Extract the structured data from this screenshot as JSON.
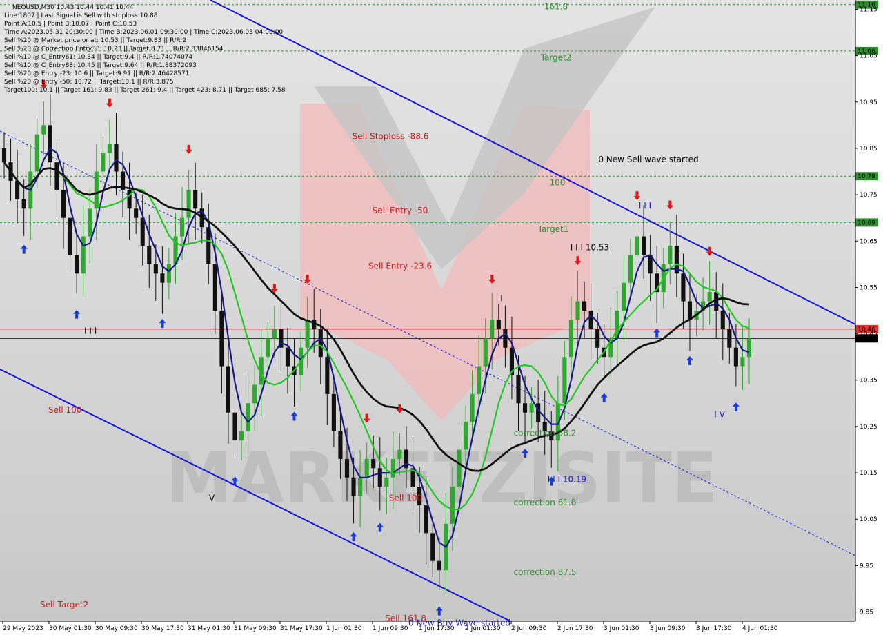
{
  "header": {
    "symbol_line": "NEOUSD,M30  10.43 10.44 10.41 10.44",
    "info_lines": [
      "Line:1807 | Last Signal is:Sell with stoploss:10.88",
      "Point A:10.5 | Point B:10.07 | Point C:10.53",
      "Time A:2023.05.31 20:30:00 | Time B:2023.06.01 09:30:00 | Time C:2023.06.03 04:00:00",
      "Sell %20 @ Market price or at: 10.53 || Target:9.83 || R/R:2",
      "Sell %20 @ Correction Entry38: 10.23 || Target:8.71 || R/R:2.33846154",
      "Sell %10 @ C_Entry61: 10.34 || Target:9.4 || R/R:1.74074074",
      "Sell %10 @ C_Entry88: 10.45 || Target:9.64 || R/R:1.88372093",
      "Sell %20 @ Entry -23: 10.6 || Target:9.91 || R/R:2.46428571",
      "Sell %20 @ Entry -50: 10.72 || Target:10.1 || R/R:3.875",
      "Target100: 10.1 || Target 161: 9.83 || Target 261: 9.4 || Target 423: 8.71 || Target 685: 7.58"
    ]
  },
  "chart_data": {
    "type": "candlestick",
    "symbol": "NEOUSD",
    "timeframe": "M30",
    "ylim": [
      9.83,
      11.17
    ],
    "y_ticks": [
      11.15,
      11.05,
      10.95,
      10.85,
      10.75,
      10.65,
      10.55,
      10.45,
      10.35,
      10.25,
      10.15,
      10.05,
      9.95,
      9.85
    ],
    "x_ticks": [
      "29 May 2023",
      "30 May 01:30",
      "30 May 09:30",
      "30 May 17:30",
      "31 May 01:30",
      "31 May 09:30",
      "31 May 17:30",
      "1 Jun 01:30",
      "1 Jun 09:30",
      "1 Jun 17:30",
      "2 Jun 01:30",
      "2 Jun 09:30",
      "2 Jun 17:30",
      "3 Jun 01:30",
      "3 Jun 09:30",
      "3 Jun 17:30",
      "4 Jun 01:30"
    ],
    "price_levels": [
      {
        "label": "11.16",
        "value": 11.16,
        "kind": "target",
        "color": "#2e8b2e"
      },
      {
        "label": "11.06",
        "value": 11.06,
        "kind": "target",
        "color": "#2e8b2e"
      },
      {
        "label": "10.79",
        "value": 10.79,
        "kind": "target",
        "color": "#2e8b2e"
      },
      {
        "label": "10.69",
        "value": 10.69,
        "kind": "target",
        "color": "#2e8b2e"
      },
      {
        "label": "10.46",
        "value": 10.46,
        "kind": "stop",
        "color": "#e03030"
      },
      {
        "label": "10.44",
        "value": 10.44,
        "kind": "current",
        "color": "#000000"
      }
    ],
    "annotations": [
      {
        "text": "161.8",
        "price": 11.15,
        "color": "#2e8b2e",
        "at": "upper-mid"
      },
      {
        "text": "Target2",
        "price": 11.04,
        "color": "#2e8b2e",
        "at": "upper-mid"
      },
      {
        "text": "Sell Stoploss -88.6",
        "price": 10.87,
        "color": "#c02020",
        "at": "upper-left-mid"
      },
      {
        "text": "0 New Sell wave started",
        "price": 10.82,
        "color": "#000000",
        "at": "upper-right"
      },
      {
        "text": "100",
        "price": 10.77,
        "color": "#2e8b2e",
        "at": "mid"
      },
      {
        "text": "Sell Entry -50",
        "price": 10.71,
        "color": "#c02020",
        "at": "left-mid"
      },
      {
        "text": "Target1",
        "price": 10.67,
        "color": "#2e8b2e",
        "at": "mid"
      },
      {
        "text": "I I I 10.53",
        "price": 10.63,
        "color": "#000000",
        "at": "mid-right"
      },
      {
        "text": "Sell Entry -23.6",
        "price": 10.59,
        "color": "#c02020",
        "at": "left-mid"
      },
      {
        "text": "I I I",
        "price": 10.72,
        "color": "#1a1ad0",
        "at": "right"
      },
      {
        "text": "I",
        "price": 10.52,
        "color": "#000000",
        "at": "mid"
      },
      {
        "text": "I I I",
        "price": 10.45,
        "color": "#000000",
        "at": "far-left"
      },
      {
        "text": "Sell 100",
        "price": 10.28,
        "color": "#c02020",
        "at": "far-left"
      },
      {
        "text": "I V",
        "price": 10.27,
        "color": "#1a1ad0",
        "at": "right"
      },
      {
        "text": "correction 38.2",
        "price": 10.23,
        "color": "#2e8b2e",
        "at": "mid"
      },
      {
        "text": "I I I 10.19",
        "price": 10.13,
        "color": "#1a1ad0",
        "at": "mid"
      },
      {
        "text": "V",
        "price": 10.09,
        "color": "#000000",
        "at": "left"
      },
      {
        "text": "Sell 100",
        "price": 10.09,
        "color": "#c02020",
        "at": "left-mid"
      },
      {
        "text": "correction 61.8",
        "price": 10.08,
        "color": "#2e8b2e",
        "at": "mid"
      },
      {
        "text": "correction 87.5",
        "price": 9.93,
        "color": "#2e8b2e",
        "at": "mid"
      },
      {
        "text": "Sell Target2",
        "price": 9.86,
        "color": "#c02020",
        "at": "far-left"
      },
      {
        "text": "Sell 161.8",
        "price": 9.83,
        "color": "#c02020",
        "at": "left-mid"
      },
      {
        "text": "0 New Buy Wave started",
        "price": 9.82,
        "color": "#1a1ad0",
        "at": "left-mid"
      }
    ],
    "close_series_approx": [
      10.82,
      10.78,
      10.74,
      10.72,
      10.8,
      10.88,
      10.9,
      10.82,
      10.76,
      10.7,
      10.62,
      10.58,
      10.66,
      10.72,
      10.8,
      10.84,
      10.86,
      10.8,
      10.76,
      10.72,
      10.7,
      10.64,
      10.6,
      10.58,
      10.56,
      10.6,
      10.66,
      10.7,
      10.76,
      10.72,
      10.68,
      10.6,
      10.5,
      10.38,
      10.28,
      10.22,
      10.24,
      10.3,
      10.34,
      10.4,
      10.44,
      10.46,
      10.42,
      10.38,
      10.36,
      10.42,
      10.48,
      10.46,
      10.4,
      10.32,
      10.24,
      10.18,
      10.14,
      10.1,
      10.14,
      10.18,
      10.16,
      10.12,
      10.14,
      10.18,
      10.2,
      10.16,
      10.12,
      10.08,
      10.02,
      9.96,
      9.94,
      10.04,
      10.12,
      10.2,
      10.26,
      10.32,
      10.38,
      10.44,
      10.48,
      10.46,
      10.42,
      10.36,
      10.3,
      10.28,
      10.3,
      10.26,
      10.24,
      10.22,
      10.3,
      10.4,
      10.48,
      10.52,
      10.5,
      10.46,
      10.42,
      10.4,
      10.44,
      10.5,
      10.56,
      10.62,
      10.66,
      10.62,
      10.58,
      10.54,
      10.6,
      10.64,
      10.58,
      10.52,
      10.48,
      10.5,
      10.52,
      10.54,
      10.5,
      10.46,
      10.42,
      10.38,
      10.4,
      10.44
    ],
    "indicators": [
      {
        "name": "",
        "color": "#1a1a80"
      },
      {
        "name": "",
        "color": "#22c822"
      },
      {
        "name": "",
        "color": "#111111"
      }
    ],
    "trend_channel": "descending",
    "grid": false
  },
  "colors": {
    "background": "#d4d4d4",
    "bull_candle": "#2ea82e",
    "bear_candle": "#111111",
    "buy_arrow": "#1a3ad8",
    "sell_arrow": "#e01818",
    "channel": "#1414d8"
  },
  "watermark": {
    "text": "MARKETZISITE"
  }
}
